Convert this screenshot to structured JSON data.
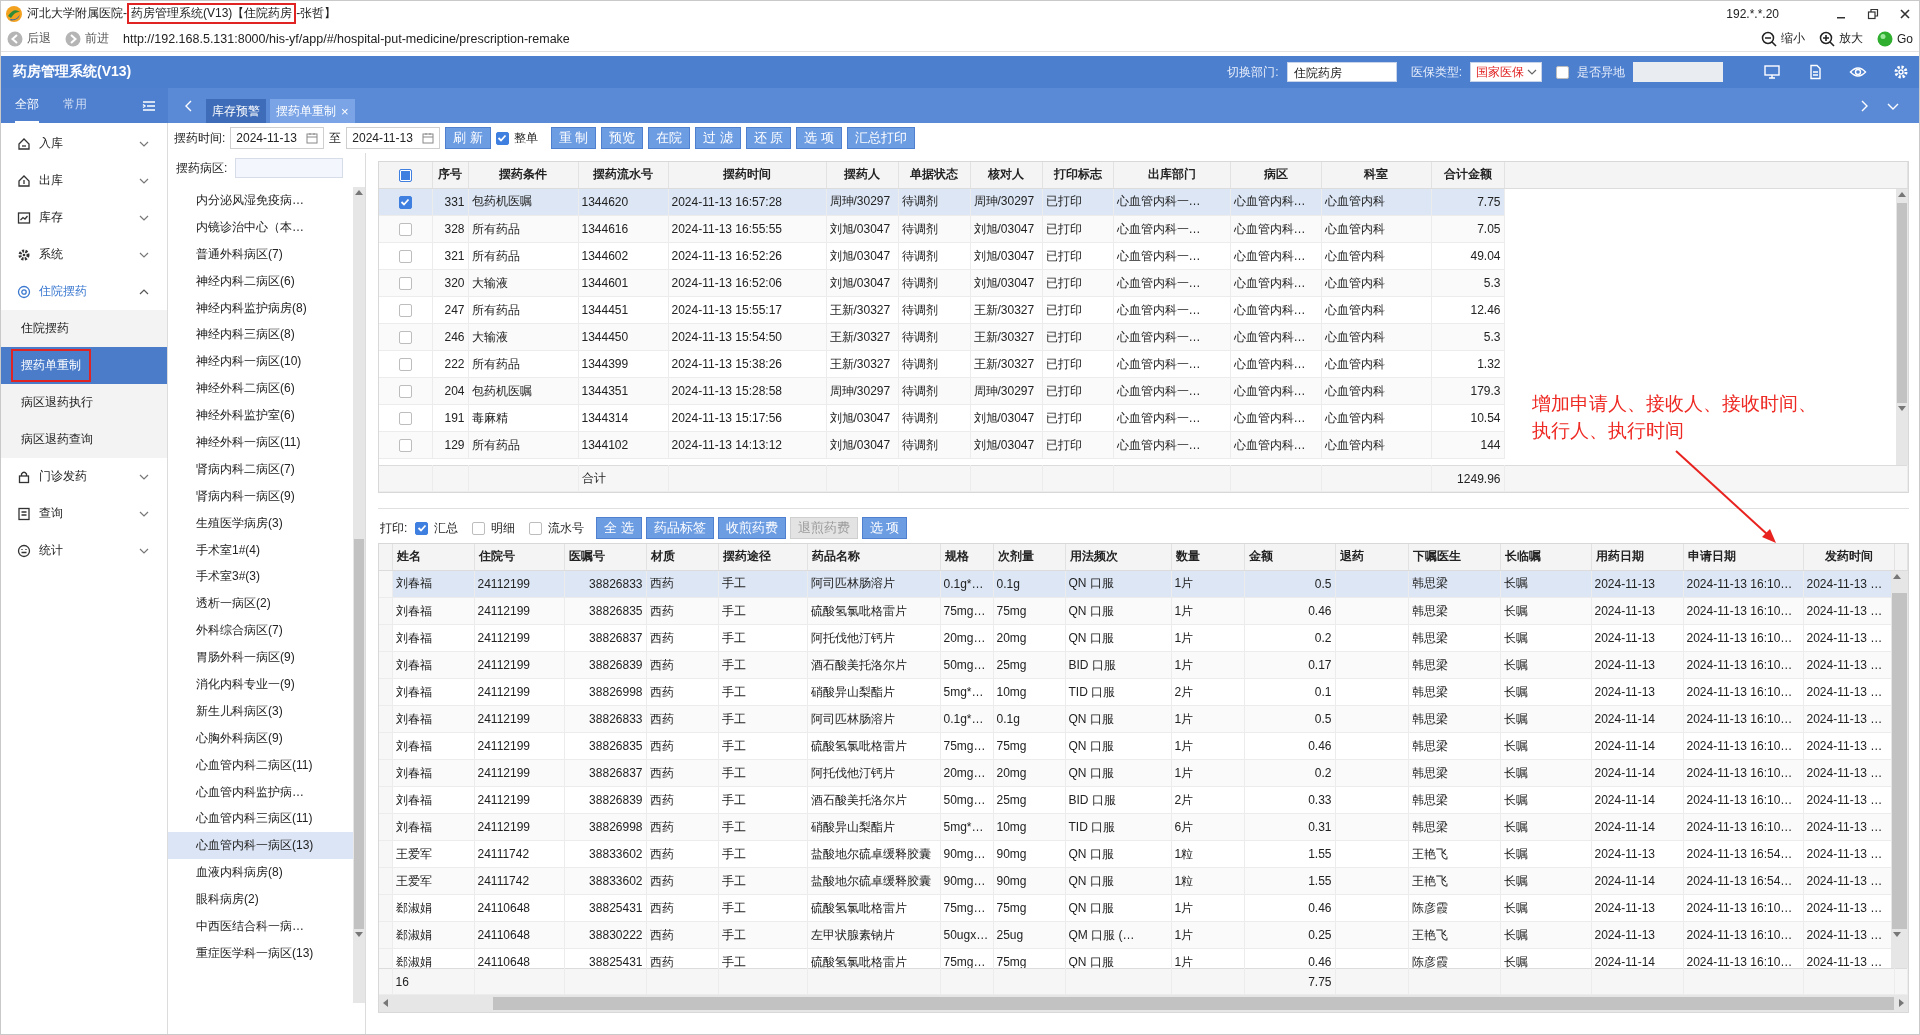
{
  "titlebar": {
    "parts": [
      {
        "text": "河北大学附属医院-",
        "boxed": false
      },
      {
        "text": "药房管理系统(V13)【住院药房",
        "boxed": true
      },
      {
        "text": "-张哲】",
        "boxed": false
      }
    ],
    "ip": "192.*.*.20"
  },
  "addressbar": {
    "back": "后退",
    "forward": "前进",
    "url": "http://192.168.5.131:8000/his-yf/app/#/hospital-put-medicine/prescription-remake",
    "zoom_out": "缩小",
    "zoom_in": "放大",
    "go": "Go"
  },
  "app_header": {
    "title": "药房管理系统(V13)",
    "dept_label": "切换部门:",
    "dept_value": "住院药房",
    "insurance_label": "医保类型:",
    "insurance_value": "国家医保",
    "remote_label": "是否异地",
    "remote_checked": false
  },
  "sidebar": {
    "tabs": [
      {
        "label": "全部",
        "selected": true
      },
      {
        "label": "常用",
        "selected": false
      }
    ],
    "items": [
      {
        "label": "入库",
        "expanded": false
      },
      {
        "label": "出库",
        "expanded": false
      },
      {
        "label": "库存",
        "expanded": false
      },
      {
        "label": "系统",
        "expanded": false
      },
      {
        "label": "住院摆药",
        "expanded": true,
        "children": [
          {
            "label": "住院摆药",
            "selected": false,
            "boxed": false
          },
          {
            "label": "摆药单重制",
            "selected": true,
            "boxed": true
          },
          {
            "label": "病区退药执行",
            "selected": false,
            "boxed": false
          },
          {
            "label": "病区退药查询",
            "selected": false,
            "boxed": false
          }
        ]
      },
      {
        "label": "门诊发药",
        "expanded": false
      },
      {
        "label": "查询",
        "expanded": false
      },
      {
        "label": "统计",
        "expanded": false
      }
    ]
  },
  "tabs": [
    {
      "label": "库存预警",
      "selected": false
    },
    {
      "label": "摆药单重制",
      "selected": true,
      "close": "×"
    }
  ],
  "toolbar": [
    {
      "kind": "label",
      "text": "摆药时间:"
    },
    {
      "kind": "date",
      "value": "2024-11-13"
    },
    {
      "kind": "label",
      "text": "至"
    },
    {
      "kind": "date",
      "value": "2024-11-13"
    },
    {
      "kind": "button",
      "label": "刷 新"
    },
    {
      "kind": "checkbox",
      "label": "整单",
      "checked": true
    },
    {
      "kind": "button",
      "label": "重 制"
    },
    {
      "kind": "button",
      "label": "预览"
    },
    {
      "kind": "button",
      "label": "在院"
    },
    {
      "kind": "button",
      "label": "过 滤"
    },
    {
      "kind": "button",
      "label": "还 原"
    },
    {
      "kind": "button",
      "label": "选 项"
    },
    {
      "kind": "button",
      "label": "汇总打印"
    }
  ],
  "ward_panel": {
    "label": "摆药病区:",
    "wards": [
      {
        "name": "内分泌风湿免疫病…",
        "selected": false
      },
      {
        "name": "内镜诊治中心（本…",
        "selected": false
      },
      {
        "name": "普通外科病区(7)",
        "selected": false
      },
      {
        "name": "神经内科二病区(6)",
        "selected": false
      },
      {
        "name": "神经内科监护病房(8)",
        "selected": false
      },
      {
        "name": "神经内科三病区(8)",
        "selected": false
      },
      {
        "name": "神经内科一病区(10)",
        "selected": false
      },
      {
        "name": "神经外科二病区(6)",
        "selected": false
      },
      {
        "name": "神经外科监护室(6)",
        "selected": false
      },
      {
        "name": "神经外科一病区(11)",
        "selected": false
      },
      {
        "name": "肾病内科二病区(7)",
        "selected": false
      },
      {
        "name": "肾病内科一病区(9)",
        "selected": false
      },
      {
        "name": "生殖医学病房(3)",
        "selected": false
      },
      {
        "name": "手术室1#(4)",
        "selected": false
      },
      {
        "name": "手术室3#(3)",
        "selected": false
      },
      {
        "name": "透析一病区(2)",
        "selected": false
      },
      {
        "name": "外科综合病区(7)",
        "selected": false
      },
      {
        "name": "胃肠外科一病区(9)",
        "selected": false
      },
      {
        "name": "消化内科专业一(9)",
        "selected": false
      },
      {
        "name": "新生儿科病区(3)",
        "selected": false
      },
      {
        "name": "心胸外科病区(9)",
        "selected": false
      },
      {
        "name": "心血管内科二病区(11)",
        "selected": false
      },
      {
        "name": "心血管内科监护病…",
        "selected": false
      },
      {
        "name": "心血管内科三病区(11)",
        "selected": false
      },
      {
        "name": "心血管内科一病区(13)",
        "selected": true
      },
      {
        "name": "血液内科病房(8)",
        "selected": false
      },
      {
        "name": "眼科病房(2)",
        "selected": false
      },
      {
        "name": "中西医结合科一病…",
        "selected": false
      },
      {
        "name": "重症医学科一病区(13)",
        "selected": false
      }
    ]
  },
  "dispense_table": {
    "select_all": {
      "checked": false,
      "indeterminate": true
    },
    "columns": [
      "序号",
      "摆药条件",
      "摆药流水号",
      "摆药时间",
      "摆药人",
      "单据状态",
      "核对人",
      "打印标志",
      "出库部门",
      "病区",
      "科室",
      "合计金额"
    ],
    "rows": [
      {
        "checked": true,
        "selected": true,
        "no": "331",
        "condition": "包药机医嘱",
        "serial": "1344620",
        "time": "2024-11-13 16:57:28",
        "dispenser": "周珅/30297",
        "status": "待调剂",
        "checker": "周珅/30297",
        "print_flag": "已打印",
        "out_dept": "心血管内科一…",
        "ward": "心血管内科…",
        "dept": "心血管内科",
        "total": "7.75"
      },
      {
        "checked": false,
        "selected": false,
        "no": "328",
        "condition": "所有药品",
        "serial": "1344616",
        "time": "2024-11-13 16:55:55",
        "dispenser": "刘旭/03047",
        "status": "待调剂",
        "checker": "刘旭/03047",
        "print_flag": "已打印",
        "out_dept": "心血管内科一…",
        "ward": "心血管内科…",
        "dept": "心血管内科",
        "total": "7.05"
      },
      {
        "checked": false,
        "selected": false,
        "no": "321",
        "condition": "所有药品",
        "serial": "1344602",
        "time": "2024-11-13 16:52:26",
        "dispenser": "刘旭/03047",
        "status": "待调剂",
        "checker": "刘旭/03047",
        "print_flag": "已打印",
        "out_dept": "心血管内科一…",
        "ward": "心血管内科…",
        "dept": "心血管内科",
        "total": "49.04"
      },
      {
        "checked": false,
        "selected": false,
        "no": "320",
        "condition": "大输液",
        "serial": "1344601",
        "time": "2024-11-13 16:52:06",
        "dispenser": "刘旭/03047",
        "status": "待调剂",
        "checker": "刘旭/03047",
        "print_flag": "已打印",
        "out_dept": "心血管内科一…",
        "ward": "心血管内科…",
        "dept": "心血管内科",
        "total": "5.3"
      },
      {
        "checked": false,
        "selected": false,
        "no": "247",
        "condition": "所有药品",
        "serial": "1344451",
        "time": "2024-11-13 15:55:17",
        "dispenser": "王新/30327",
        "status": "待调剂",
        "checker": "王新/30327",
        "print_flag": "已打印",
        "out_dept": "心血管内科一…",
        "ward": "心血管内科…",
        "dept": "心血管内科",
        "total": "12.46"
      },
      {
        "checked": false,
        "selected": false,
        "no": "246",
        "condition": "大输液",
        "serial": "1344450",
        "time": "2024-11-13 15:54:50",
        "dispenser": "王新/30327",
        "status": "待调剂",
        "checker": "王新/30327",
        "print_flag": "已打印",
        "out_dept": "心血管内科一…",
        "ward": "心血管内科…",
        "dept": "心血管内科",
        "total": "5.3"
      },
      {
        "checked": false,
        "selected": false,
        "no": "222",
        "condition": "所有药品",
        "serial": "1344399",
        "time": "2024-11-13 15:38:26",
        "dispenser": "王新/30327",
        "status": "待调剂",
        "checker": "王新/30327",
        "print_flag": "已打印",
        "out_dept": "心血管内科一…",
        "ward": "心血管内科…",
        "dept": "心血管内科",
        "total": "1.32"
      },
      {
        "checked": false,
        "selected": false,
        "no": "204",
        "condition": "包药机医嘱",
        "serial": "1344351",
        "time": "2024-11-13 15:28:58",
        "dispenser": "周珅/30297",
        "status": "待调剂",
        "checker": "周珅/30297",
        "print_flag": "已打印",
        "out_dept": "心血管内科一…",
        "ward": "心血管内科…",
        "dept": "心血管内科",
        "total": "179.3"
      },
      {
        "checked": false,
        "selected": false,
        "no": "191",
        "condition": "毒麻精",
        "serial": "1344314",
        "time": "2024-11-13 15:17:56",
        "dispenser": "刘旭/03047",
        "status": "待调剂",
        "checker": "刘旭/03047",
        "print_flag": "已打印",
        "out_dept": "心血管内科一…",
        "ward": "心血管内科…",
        "dept": "心血管内科",
        "total": "10.54"
      },
      {
        "checked": false,
        "selected": false,
        "no": "129",
        "condition": "所有药品",
        "serial": "1344102",
        "time": "2024-11-13 14:13:12",
        "dispenser": "刘旭/03047",
        "status": "待调剂",
        "checker": "刘旭/03047",
        "print_flag": "已打印",
        "out_dept": "心血管内科一…",
        "ward": "心血管内科…",
        "dept": "心血管内科",
        "total": "144"
      }
    ],
    "footer": {
      "label": "合计",
      "total": "1249.96"
    }
  },
  "annotation": {
    "text": "增加申请人、接收人、接收时间、执行人、执行时间"
  },
  "print_options": {
    "label": "打印:",
    "checkboxes": [
      {
        "label": "汇总",
        "checked": true
      },
      {
        "label": "明细",
        "checked": false
      },
      {
        "label": "流水号",
        "checked": false
      }
    ],
    "buttons": [
      {
        "label": "全 选",
        "disabled": false
      },
      {
        "label": "药品标签",
        "disabled": false
      },
      {
        "label": "收煎药费",
        "disabled": false
      },
      {
        "label": "退煎药费",
        "disabled": true
      },
      {
        "label": "选 项",
        "disabled": false
      }
    ]
  },
  "detail_table": {
    "columns": [
      "姓名",
      "住院号",
      "医嘱号",
      "材质",
      "摆药途径",
      "药品名称",
      "规格",
      "次剂量",
      "用法频次",
      "数量",
      "金额",
      "退药",
      "下嘱医生",
      "长临嘱",
      "用药日期",
      "申请日期",
      "发药时间"
    ],
    "rows": [
      {
        "selected": true,
        "name": "刘春福",
        "inpatient_no": "24112199",
        "order_no": "38826833",
        "material": "西药",
        "route": "手工",
        "drug": "阿司匹林肠溶片",
        "spec": "0.1g*…",
        "dose": "0.1g",
        "usage": "QN 口服",
        "qty": "1片",
        "amount": "0.5",
        "doctor": "韩思梁",
        "order_type": "长嘱",
        "use_date": "2024-11-13",
        "apply_date": "2024-11-13 16:10…",
        "dispense_time": "2024-11-13 …"
      },
      {
        "selected": false,
        "name": "刘春福",
        "inpatient_no": "24112199",
        "order_no": "38826835",
        "material": "西药",
        "route": "手工",
        "drug": "硫酸氢氯吡格雷片",
        "spec": "75mg…",
        "dose": "75mg",
        "usage": "QN 口服",
        "qty": "1片",
        "amount": "0.46",
        "doctor": "韩思梁",
        "order_type": "长嘱",
        "use_date": "2024-11-13",
        "apply_date": "2024-11-13 16:10…",
        "dispense_time": "2024-11-13 …"
      },
      {
        "selected": false,
        "name": "刘春福",
        "inpatient_no": "24112199",
        "order_no": "38826837",
        "material": "西药",
        "route": "手工",
        "drug": "阿托伐他汀钙片",
        "spec": "20mg…",
        "dose": "20mg",
        "usage": "QN 口服",
        "qty": "1片",
        "amount": "0.2",
        "doctor": "韩思梁",
        "order_type": "长嘱",
        "use_date": "2024-11-13",
        "apply_date": "2024-11-13 16:10…",
        "dispense_time": "2024-11-13 …"
      },
      {
        "selected": false,
        "name": "刘春福",
        "inpatient_no": "24112199",
        "order_no": "38826839",
        "material": "西药",
        "route": "手工",
        "drug": "酒石酸美托洛尔片",
        "spec": "50mg…",
        "dose": "25mg",
        "usage": "BID 口服",
        "qty": "1片",
        "amount": "0.17",
        "doctor": "韩思梁",
        "order_type": "长嘱",
        "use_date": "2024-11-13",
        "apply_date": "2024-11-13 16:10…",
        "dispense_time": "2024-11-13 …"
      },
      {
        "selected": false,
        "name": "刘春福",
        "inpatient_no": "24112199",
        "order_no": "38826998",
        "material": "西药",
        "route": "手工",
        "drug": "硝酸异山梨酯片",
        "spec": "5mg*…",
        "dose": "10mg",
        "usage": "TID 口服",
        "qty": "2片",
        "amount": "0.1",
        "doctor": "韩思梁",
        "order_type": "长嘱",
        "use_date": "2024-11-13",
        "apply_date": "2024-11-13 16:10…",
        "dispense_time": "2024-11-13 …"
      },
      {
        "selected": false,
        "name": "刘春福",
        "inpatient_no": "24112199",
        "order_no": "38826833",
        "material": "西药",
        "route": "手工",
        "drug": "阿司匹林肠溶片",
        "spec": "0.1g*…",
        "dose": "0.1g",
        "usage": "QN 口服",
        "qty": "1片",
        "amount": "0.5",
        "doctor": "韩思梁",
        "order_type": "长嘱",
        "use_date": "2024-11-14",
        "apply_date": "2024-11-13 16:10…",
        "dispense_time": "2024-11-13 …"
      },
      {
        "selected": false,
        "name": "刘春福",
        "inpatient_no": "24112199",
        "order_no": "38826835",
        "material": "西药",
        "route": "手工",
        "drug": "硫酸氢氯吡格雷片",
        "spec": "75mg…",
        "dose": "75mg",
        "usage": "QN 口服",
        "qty": "1片",
        "amount": "0.46",
        "doctor": "韩思梁",
        "order_type": "长嘱",
        "use_date": "2024-11-14",
        "apply_date": "2024-11-13 16:10…",
        "dispense_time": "2024-11-13 …"
      },
      {
        "selected": false,
        "name": "刘春福",
        "inpatient_no": "24112199",
        "order_no": "38826837",
        "material": "西药",
        "route": "手工",
        "drug": "阿托伐他汀钙片",
        "spec": "20mg…",
        "dose": "20mg",
        "usage": "QN 口服",
        "qty": "1片",
        "amount": "0.2",
        "doctor": "韩思梁",
        "order_type": "长嘱",
        "use_date": "2024-11-14",
        "apply_date": "2024-11-13 16:10…",
        "dispense_time": "2024-11-13 …"
      },
      {
        "selected": false,
        "name": "刘春福",
        "inpatient_no": "24112199",
        "order_no": "38826839",
        "material": "西药",
        "route": "手工",
        "drug": "酒石酸美托洛尔片",
        "spec": "50mg…",
        "dose": "25mg",
        "usage": "BID 口服",
        "qty": "2片",
        "amount": "0.33",
        "doctor": "韩思梁",
        "order_type": "长嘱",
        "use_date": "2024-11-14",
        "apply_date": "2024-11-13 16:10…",
        "dispense_time": "2024-11-13 …"
      },
      {
        "selected": false,
        "name": "刘春福",
        "inpatient_no": "24112199",
        "order_no": "38826998",
        "material": "西药",
        "route": "手工",
        "drug": "硝酸异山梨酯片",
        "spec": "5mg*…",
        "dose": "10mg",
        "usage": "TID 口服",
        "qty": "6片",
        "amount": "0.31",
        "doctor": "韩思梁",
        "order_type": "长嘱",
        "use_date": "2024-11-14",
        "apply_date": "2024-11-13 16:10…",
        "dispense_time": "2024-11-13 …"
      },
      {
        "selected": false,
        "name": "王爱军",
        "inpatient_no": "24111742",
        "order_no": "38833602",
        "material": "西药",
        "route": "手工",
        "drug": "盐酸地尔硫卓缓释胶囊",
        "spec": "90mg…",
        "dose": "90mg",
        "usage": "QN 口服",
        "qty": "1粒",
        "amount": "1.55",
        "doctor": "王艳飞",
        "order_type": "长嘱",
        "use_date": "2024-11-13",
        "apply_date": "2024-11-13 16:54…",
        "dispense_time": "2024-11-13 …"
      },
      {
        "selected": false,
        "name": "王爱军",
        "inpatient_no": "24111742",
        "order_no": "38833602",
        "material": "西药",
        "route": "手工",
        "drug": "盐酸地尔硫卓缓释胶囊",
        "spec": "90mg…",
        "dose": "90mg",
        "usage": "QN 口服",
        "qty": "1粒",
        "amount": "1.55",
        "doctor": "王艳飞",
        "order_type": "长嘱",
        "use_date": "2024-11-14",
        "apply_date": "2024-11-13 16:54…",
        "dispense_time": "2024-11-13 …"
      },
      {
        "selected": false,
        "name": "郄淑娟",
        "inpatient_no": "24110648",
        "order_no": "38825431",
        "material": "西药",
        "route": "手工",
        "drug": "硫酸氢氯吡格雷片",
        "spec": "75mg…",
        "dose": "75mg",
        "usage": "QN 口服",
        "qty": "1片",
        "amount": "0.46",
        "doctor": "陈彦霞",
        "order_type": "长嘱",
        "use_date": "2024-11-13",
        "apply_date": "2024-11-13 16:10…",
        "dispense_time": "2024-11-13 …"
      },
      {
        "selected": false,
        "name": "郄淑娟",
        "inpatient_no": "24110648",
        "order_no": "38830222",
        "material": "西药",
        "route": "手工",
        "drug": "左甲状腺素钠片",
        "spec": "50ugx…",
        "dose": "25ug",
        "usage": "QM 口服 (…",
        "qty": "1片",
        "amount": "0.25",
        "doctor": "王艳飞",
        "order_type": "长嘱",
        "use_date": "2024-11-13",
        "apply_date": "2024-11-13 16:10…",
        "dispense_time": "2024-11-13 …"
      },
      {
        "selected": false,
        "name": "郄淑娟",
        "inpatient_no": "24110648",
        "order_no": "38825431",
        "material": "西药",
        "route": "手工",
        "drug": "硫酸氢氯吡格雷片",
        "spec": "75mg…",
        "dose": "75mg",
        "usage": "QN 口服",
        "qty": "1片",
        "amount": "0.46",
        "doctor": "陈彦霞",
        "order_type": "长嘱",
        "use_date": "2024-11-14",
        "apply_date": "2024-11-13 16:10…",
        "dispense_time": "2024-11-13 …"
      }
    ],
    "footer": {
      "count": "16",
      "amount": "7.75"
    }
  }
}
